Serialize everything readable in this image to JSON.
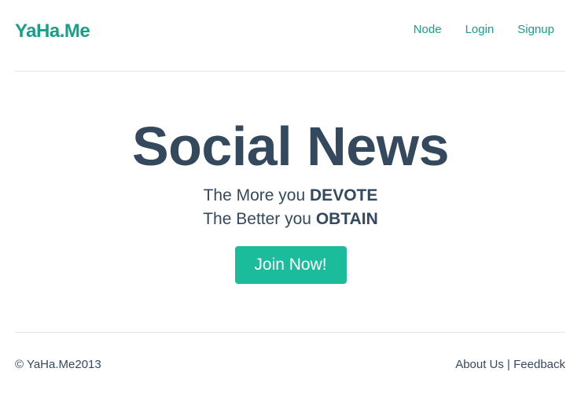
{
  "header": {
    "brand": "YaHa.Me",
    "nav": [
      {
        "label": "Node"
      },
      {
        "label": "Login"
      },
      {
        "label": "Signup"
      }
    ]
  },
  "hero": {
    "title": "Social News",
    "line1_prefix": "The More you ",
    "line1_emphasis": "DEVOTE",
    "line2_prefix": "The Better you ",
    "line2_emphasis": "OBTAIN",
    "cta_label": "Join Now!"
  },
  "footer": {
    "copyright": "© YaHa.Me2013",
    "about_label": "About Us",
    "separator": " | ",
    "feedback_label": "Feedback"
  },
  "colors": {
    "brand": "#16a085",
    "text": "#34495e",
    "button": "#1abc9c"
  }
}
